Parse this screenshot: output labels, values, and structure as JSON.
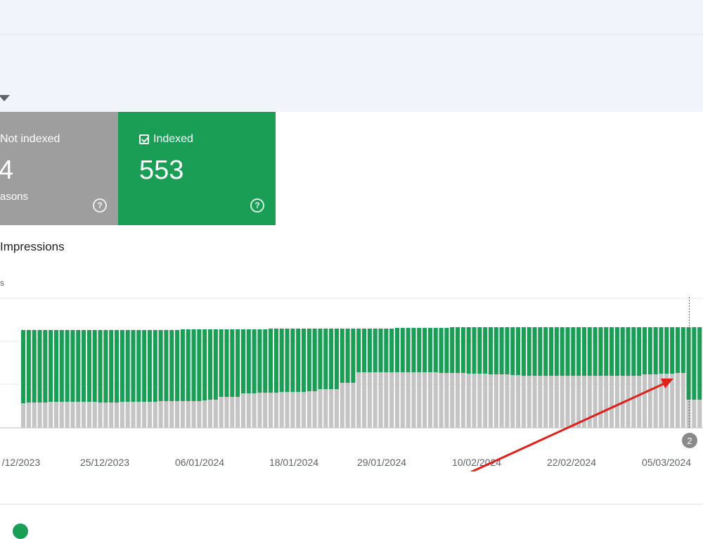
{
  "cards": {
    "not_indexed": {
      "label": "Not indexed",
      "count": "4",
      "sub": "asons"
    },
    "indexed": {
      "label": "Indexed",
      "count": "553"
    }
  },
  "chart_heading": "Impressions",
  "y_label": "s",
  "colors": {
    "indexed": "#1a9e56",
    "not_indexed": "#c4c4c4",
    "arrow": "#e0201b",
    "grid": "#e8e8e8"
  },
  "icons": {
    "indexed_check": "checkbox-icon",
    "help": "help-icon"
  },
  "chart_data": {
    "type": "bar",
    "stacked": true,
    "date_labels": [
      "/12/2023",
      "25/12/2023",
      "06/01/2024",
      "18/01/2024",
      "29/01/2024",
      "10/02/2024",
      "22/02/2024",
      "05/03/2024"
    ],
    "annotation": "2",
    "series": [
      {
        "name": "Not indexed",
        "values": [
          35,
          36,
          36,
          36,
          36,
          37,
          37,
          37,
          37,
          37,
          37,
          37,
          37,
          37,
          36,
          36,
          36,
          36,
          37,
          37,
          37,
          37,
          37,
          37,
          37,
          38,
          38,
          38,
          38,
          38,
          38,
          38,
          38,
          39,
          40,
          40,
          44,
          44,
          44,
          44,
          49,
          49,
          49,
          50,
          50,
          50,
          50,
          51,
          51,
          51,
          51,
          51,
          52,
          52,
          55,
          55,
          55,
          55,
          64,
          64,
          64,
          79,
          79,
          79,
          79,
          79,
          79,
          79,
          79,
          79,
          79,
          79,
          79,
          79,
          79,
          79,
          78,
          78,
          78,
          78,
          78,
          77,
          77,
          77,
          77,
          76,
          76,
          76,
          76,
          75,
          75,
          74,
          74,
          74,
          74,
          74,
          74,
          74,
          74,
          74,
          74,
          74,
          74,
          74,
          74,
          74,
          74,
          74,
          74,
          74,
          74,
          74,
          74,
          76,
          76,
          76,
          77,
          77,
          77,
          78,
          78,
          40,
          40,
          40
        ]
      },
      {
        "name": "Indexed",
        "values": [
          139,
          139,
          139,
          139,
          139,
          139,
          139,
          139,
          139,
          139,
          139,
          139,
          139,
          139,
          139,
          139,
          139,
          139,
          139,
          139,
          139,
          139,
          139,
          139,
          139,
          139,
          139,
          139,
          139,
          140,
          140,
          140,
          140,
          140,
          140,
          140,
          140,
          140,
          140,
          140,
          140,
          140,
          140,
          140,
          140,
          141,
          141,
          141,
          141,
          141,
          141,
          141,
          141,
          141,
          141,
          141,
          141,
          141,
          141,
          141,
          141,
          141,
          141,
          141,
          141,
          141,
          141,
          141,
          142,
          142,
          142,
          142,
          142,
          142,
          142,
          142,
          142,
          142,
          143,
          143,
          143,
          143,
          143,
          143,
          143,
          143,
          143,
          143,
          143,
          143,
          143,
          143,
          143,
          143,
          143,
          143,
          143,
          143,
          143,
          143,
          143,
          143,
          143,
          143,
          143,
          143,
          143,
          143,
          143,
          143,
          143,
          143,
          143,
          143,
          143,
          143,
          143,
          143,
          143,
          143,
          143,
          143,
          143,
          143,
          143
        ]
      }
    ]
  }
}
